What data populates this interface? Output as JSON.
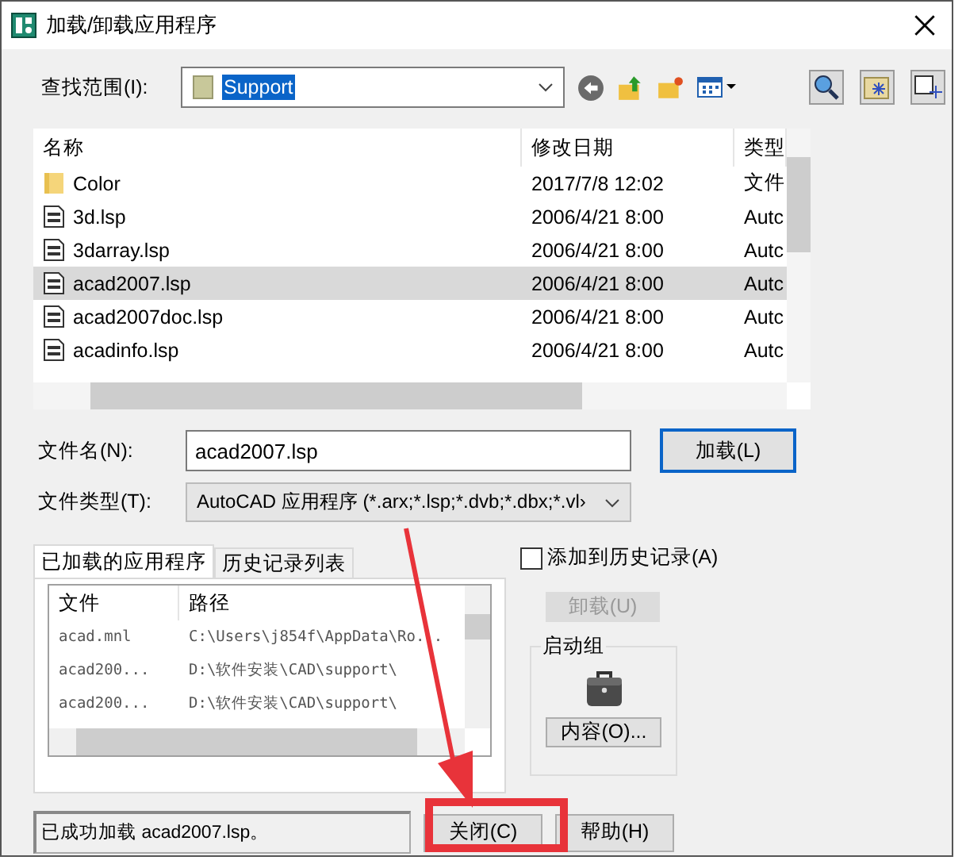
{
  "window": {
    "title": "加载/卸载应用程序"
  },
  "lookin": {
    "label": "查找范围(I):",
    "value": "Support"
  },
  "files": {
    "columns": [
      "名称",
      "修改日期",
      "类型"
    ],
    "rows": [
      {
        "kind": "folder",
        "name": "Color",
        "date": "2017/7/8 12:02",
        "type": "文件",
        "selected": false
      },
      {
        "kind": "lsp",
        "name": "3d.lsp",
        "date": "2006/4/21 8:00",
        "type": "Autc",
        "selected": false
      },
      {
        "kind": "lsp",
        "name": "3darray.lsp",
        "date": "2006/4/21 8:00",
        "type": "Autc",
        "selected": false
      },
      {
        "kind": "lsp",
        "name": "acad2007.lsp",
        "date": "2006/4/21 8:00",
        "type": "Autc",
        "selected": true
      },
      {
        "kind": "lsp",
        "name": "acad2007doc.lsp",
        "date": "2006/4/21 8:00",
        "type": "Autc",
        "selected": false
      },
      {
        "kind": "lsp",
        "name": "acadinfo.lsp",
        "date": "2006/4/21 8:00",
        "type": "Autc",
        "selected": false
      }
    ]
  },
  "filename": {
    "label": "文件名(N):",
    "value": "acad2007.lsp"
  },
  "filetype": {
    "label": "文件类型(T):",
    "value": "AutoCAD 应用程序 (*.arx;*.lsp;*.dvb;*.dbx;*.vl›"
  },
  "load_button": "加载(L)",
  "tabs": [
    {
      "label": "已加载的应用程序",
      "selected": true
    },
    {
      "label": "历史记录列表",
      "selected": false
    }
  ],
  "loaded": {
    "columns": [
      "文件",
      "路径"
    ],
    "rows": [
      {
        "file": "acad.mnl",
        "path": "C:\\Users\\j854f\\AppData\\Ro..."
      },
      {
        "file": "acad200...",
        "path": "D:\\软件安装\\CAD\\support\\"
      },
      {
        "file": "acad200...",
        "path": "D:\\软件安装\\CAD\\support\\"
      }
    ]
  },
  "add_to_history": {
    "label": "添加到历史记录(A)",
    "checked": false
  },
  "unload_button": {
    "label": "卸载(U)",
    "disabled": true
  },
  "startup": {
    "title": "启动组",
    "button": "内容(O)..."
  },
  "status": "已成功加载 acad2007.lsp。",
  "buttons": [
    "关闭(C)",
    "帮助(H)"
  ]
}
